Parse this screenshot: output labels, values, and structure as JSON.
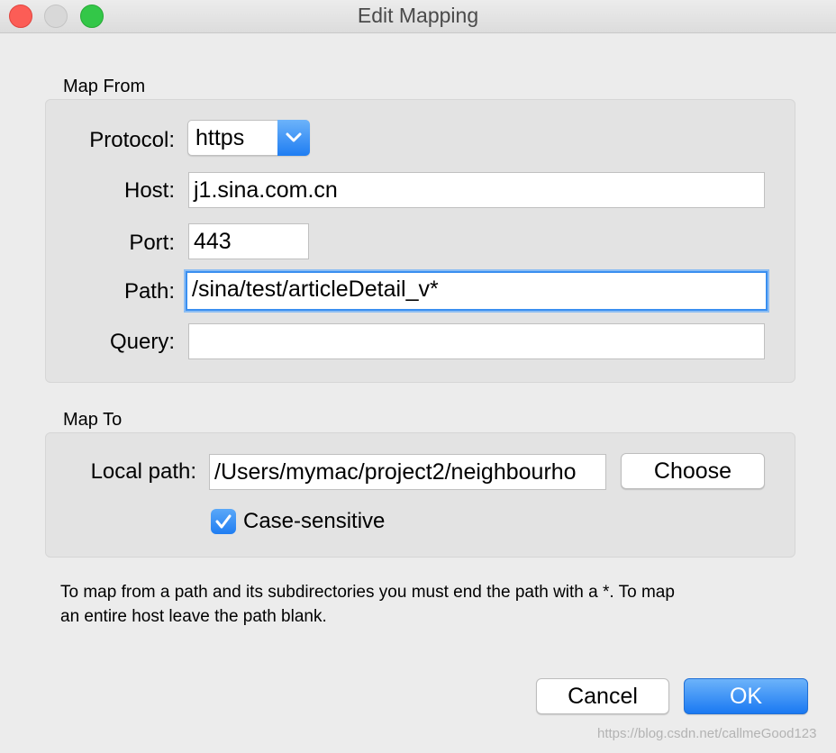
{
  "window": {
    "title": "Edit Mapping"
  },
  "map_from": {
    "heading": "Map From",
    "protocol_label": "Protocol:",
    "protocol_value": "https",
    "host_label": "Host:",
    "host_value": "j1.sina.com.cn",
    "port_label": "Port:",
    "port_value": "443",
    "path_label": "Path:",
    "path_value": "/sina/test/articleDetail_v*",
    "query_label": "Query:",
    "query_value": ""
  },
  "map_to": {
    "heading": "Map To",
    "local_path_label": "Local path:",
    "local_path_value": "/Users/mymac/project2/neighbourho",
    "choose_label": "Choose",
    "case_sensitive_label": "Case-sensitive",
    "case_sensitive_checked": true
  },
  "help_text_line1": "To map from a path and its subdirectories you must end the path with a *. To map",
  "help_text_line2": "an entire host leave the path blank.",
  "buttons": {
    "cancel": "Cancel",
    "ok": "OK"
  },
  "watermark": "https://blog.csdn.net/callmeGood123",
  "colors": {
    "accent": "#3a8ff0",
    "close": "#fc5d56",
    "maximize": "#33c748"
  }
}
